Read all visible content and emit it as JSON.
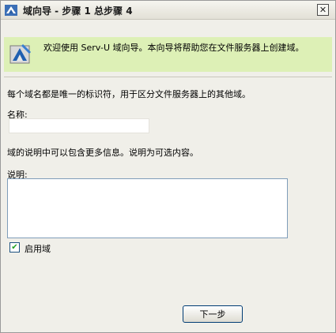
{
  "window": {
    "title": "域向导 - 步骤 1 总步骤 4",
    "close_label": "✕"
  },
  "banner": {
    "text": "欢迎使用 Serv-U 域向导。本向导将帮助您在文件服务器上创建域。"
  },
  "form": {
    "intro": "每个域名都是唯一的标识符，用于区分文件服务器上的其他域。",
    "name_label": "名称:",
    "name_value": "",
    "desc_info": "域的说明中可以包含更多信息。说明为可选内容。",
    "desc_label": "说明:",
    "desc_value": "",
    "enable_label": "启用域",
    "enable_checked": true,
    "check_mark": "✔"
  },
  "buttons": {
    "next_label": "下一步"
  },
  "icons": {
    "title": "serv-u-icon",
    "banner": "serv-u-wizard-icon",
    "close": "close-icon"
  }
}
